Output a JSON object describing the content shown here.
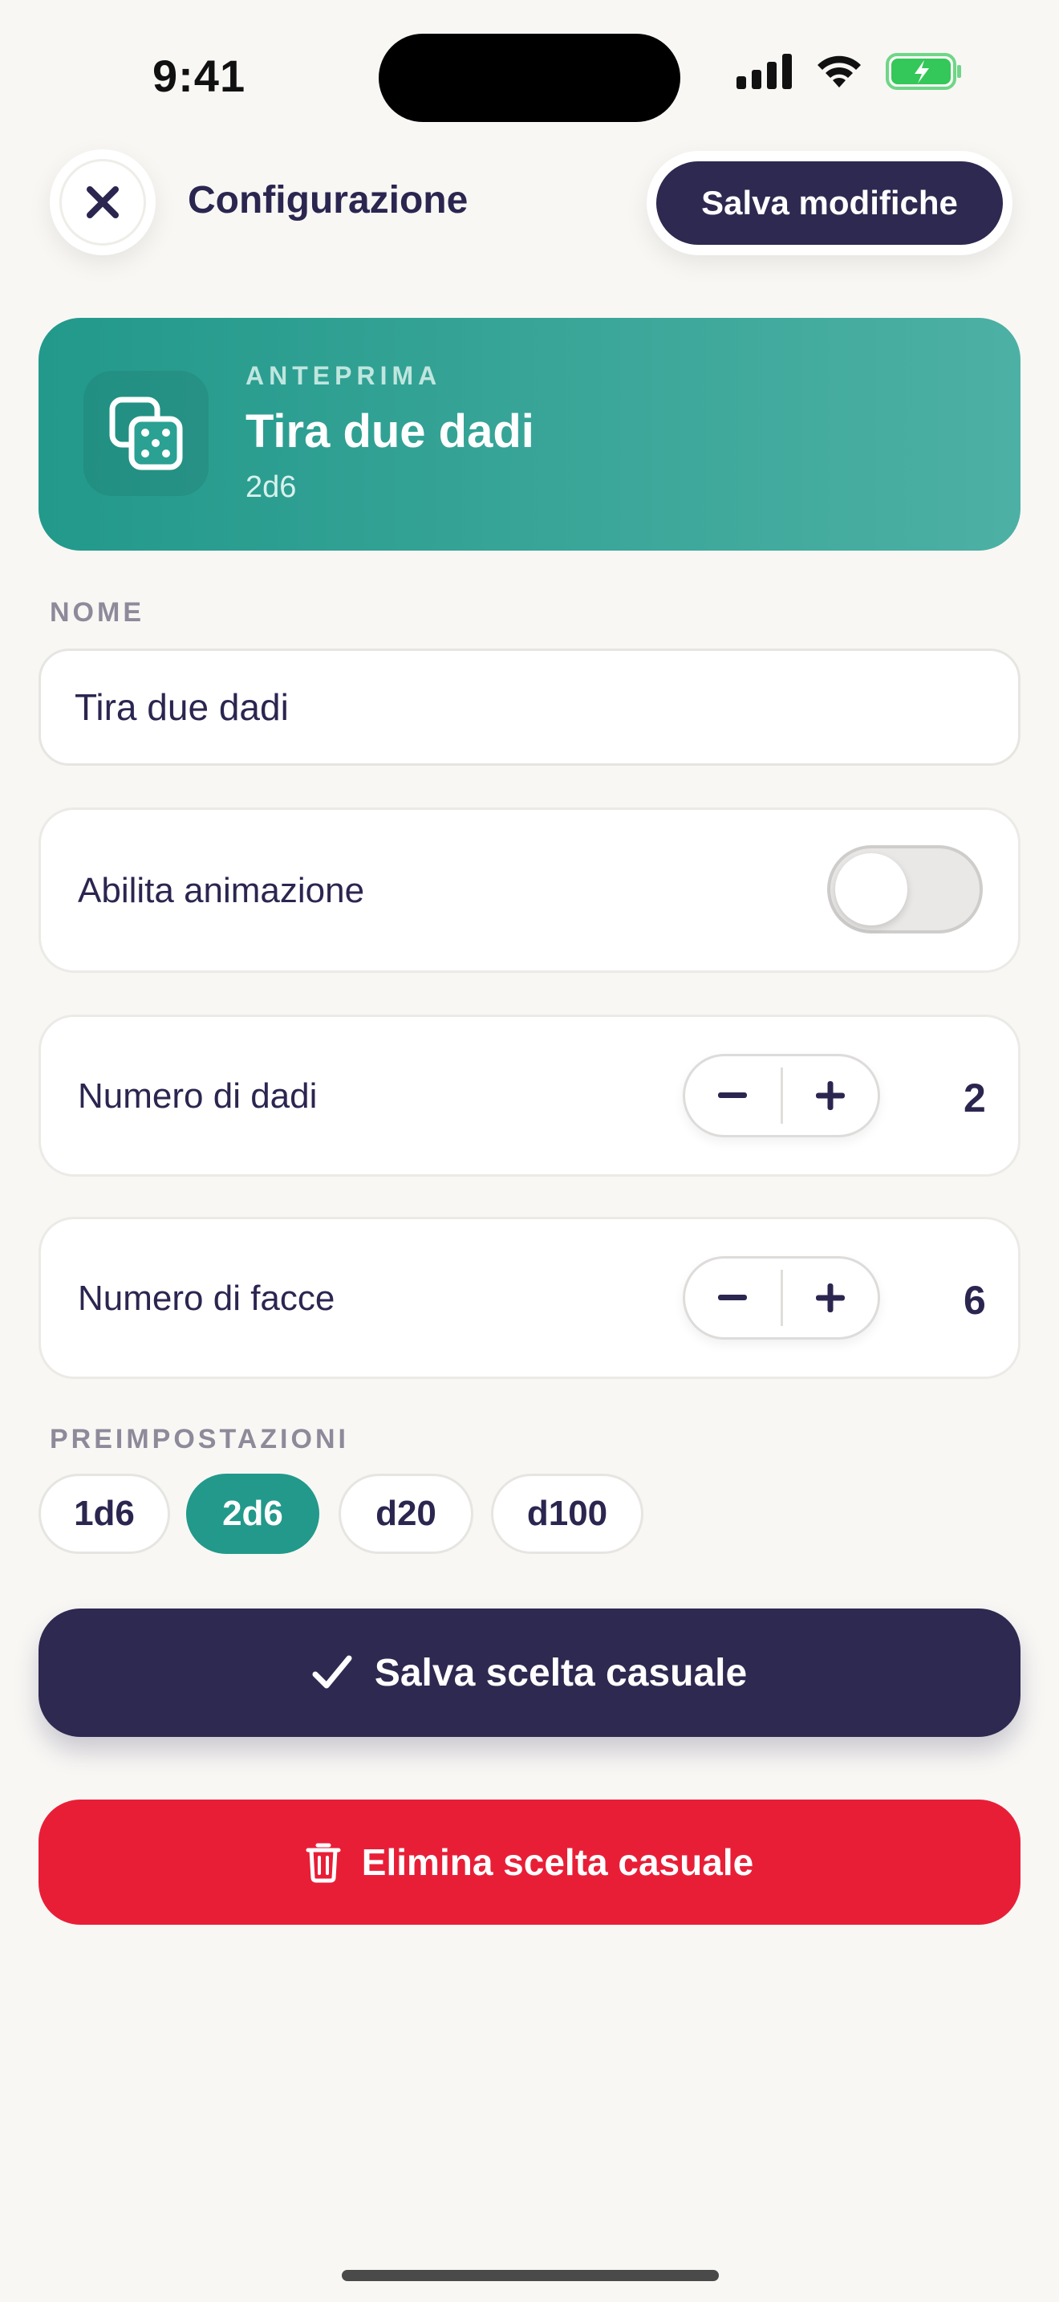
{
  "status_bar": {
    "time": "9:41",
    "signal_icon": "cellular-signal-icon",
    "wifi_icon": "wifi-icon",
    "battery_icon": "battery-charging-icon"
  },
  "header": {
    "close_icon": "close-icon",
    "title": "Configurazione",
    "save_label": "Salva modifiche"
  },
  "preview": {
    "icon": "dice-icon",
    "label": "ANTEPRIMA",
    "title": "Tira due dadi",
    "notation": "2d6"
  },
  "name": {
    "section_label": "NOME",
    "value": "Tira due dadi"
  },
  "animation": {
    "label": "Abilita animazione",
    "enabled": false
  },
  "dice_count": {
    "label": "Numero di dadi",
    "value": "2"
  },
  "face_count": {
    "label": "Numero di facce",
    "value": "6"
  },
  "presets": {
    "section_label": "PREIMPOSTAZIONI",
    "items": [
      "1d6",
      "2d6",
      "d20",
      "d100"
    ],
    "selected": "2d6"
  },
  "primary_action": {
    "label": "Salva scelta casuale",
    "icon": "checkmark-icon"
  },
  "delete_action": {
    "label": "Elimina scelta casuale",
    "icon": "trash-icon"
  },
  "colors": {
    "accent": "#22998B",
    "primary": "#2D2950",
    "danger": "#E81E37",
    "background": "#F8F7F4"
  }
}
